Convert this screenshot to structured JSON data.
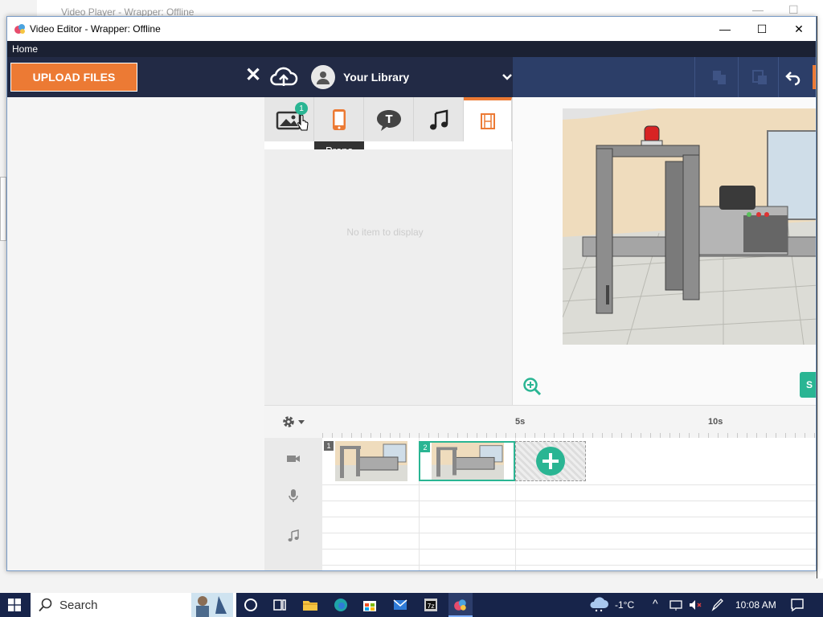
{
  "background_window": {
    "title": "Video Player - Wrapper: Offline"
  },
  "window": {
    "title": "Video Editor - Wrapper: Offline"
  },
  "menu": {
    "home": "Home"
  },
  "toolbar": {
    "upload_label": "UPLOAD FILES",
    "library_label": "Your Library"
  },
  "asset_tabs": {
    "badge_count": "1",
    "tooltip": "Props",
    "empty_message": "No item to display"
  },
  "stage": {
    "side_button_label": "S"
  },
  "timeline": {
    "ruler_labels": [
      "5s",
      "10s"
    ],
    "clips": [
      {
        "number": "1",
        "selected": false
      },
      {
        "number": "2",
        "selected": true
      }
    ]
  },
  "taskbar": {
    "search_label": "Search",
    "temperature": "-1°C",
    "time": "10:08 AM"
  },
  "colors": {
    "accent_orange": "#ec7a34",
    "accent_green": "#2ab593",
    "toolbar_navy": "#222a45"
  }
}
